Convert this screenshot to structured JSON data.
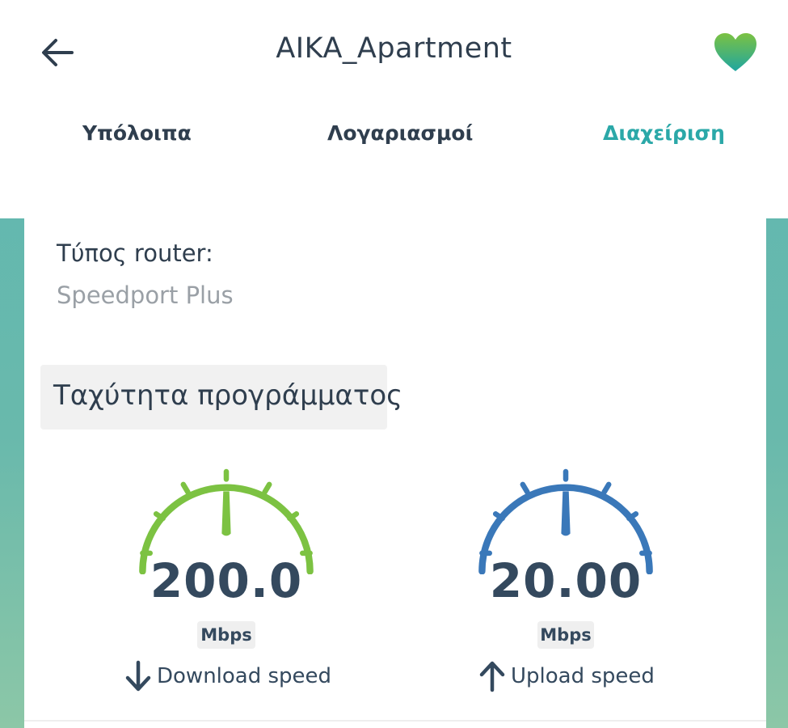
{
  "header": {
    "title": "AIKA_Apartment",
    "back_icon": "arrow-left-icon",
    "favorite_icon": "heart-icon"
  },
  "tabs": [
    {
      "label": "Υπόλοιπα",
      "active": false
    },
    {
      "label": "Λογαριασμοί",
      "active": false
    },
    {
      "label": "Διαχείριση",
      "active": true
    }
  ],
  "router": {
    "label": "Τύπος router:",
    "value": "Speedport Plus"
  },
  "program_speed": {
    "title": "Ταχύτητα προγράμματος",
    "download": {
      "value": "200.0",
      "unit": "Mbps",
      "label": "Download speed",
      "icon": "arrow-down-icon",
      "color": "#7cc242"
    },
    "upload": {
      "value": "20.00",
      "unit": "Mbps",
      "label": "Upload speed",
      "icon": "arrow-up-icon",
      "color": "#3a78b9"
    }
  },
  "colors": {
    "accent": "#2ba8a8",
    "text": "#2f3e4e",
    "background_gradient": "#5fb8b2"
  }
}
